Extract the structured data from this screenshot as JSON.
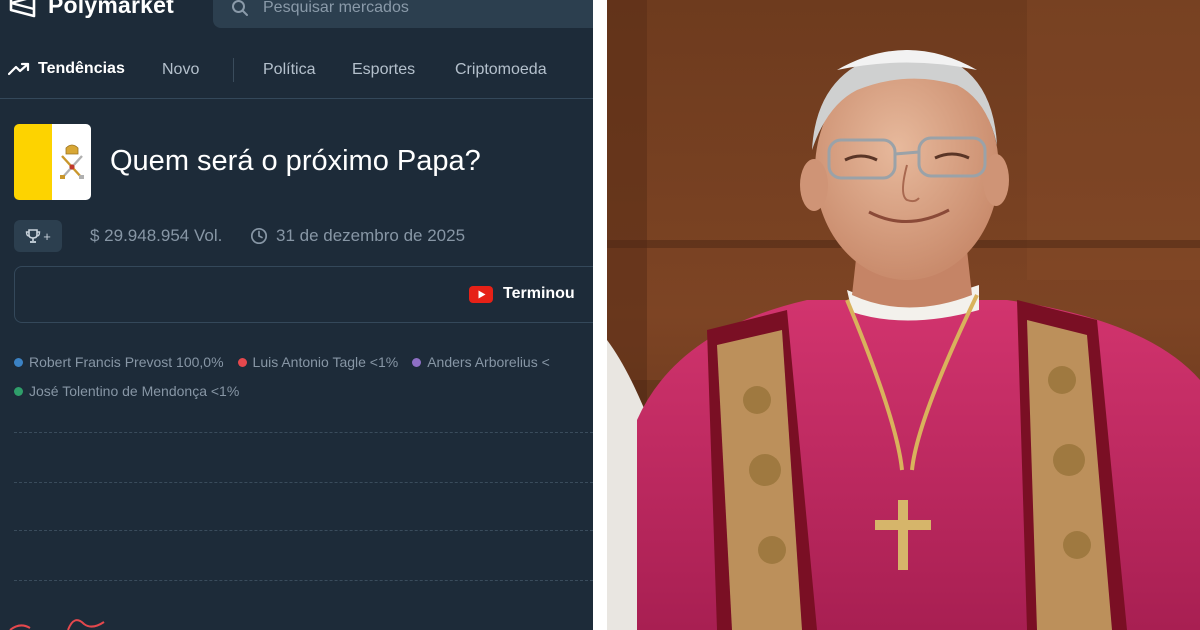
{
  "app": {
    "name": "Polymarket",
    "search_placeholder": "Pesquisar mercados"
  },
  "nav": {
    "trending": "Tendências",
    "items": [
      "Novo",
      "Política",
      "Esportes",
      "Criptomoeda"
    ]
  },
  "market": {
    "title": "Quem será o próximo Papa?",
    "volume": "$ 29.948.954 Vol.",
    "end_date": "31 de dezembro de 2025",
    "status": "Terminou",
    "trophy_suffix": "+"
  },
  "legend": [
    {
      "label": "Robert Francis Prevost 100,0%",
      "color": "#3b82c4"
    },
    {
      "label": "Luis Antonio Tagle <1%",
      "color": "#e5484d"
    },
    {
      "label": "Anders Arborelius <",
      "color": "#8e6fc5"
    },
    {
      "label": "José Tolentino de Mendonça <1%",
      "color": "#2f9e6a"
    }
  ],
  "colors": {
    "panel_bg": "#1d2b39",
    "flag_yellow": "#fdd300",
    "youtube_red": "#e62117"
  },
  "icons": [
    "polymarket-logo-icon",
    "search-icon",
    "trending-icon",
    "trophy-icon",
    "clock-icon",
    "youtube-icon",
    "papal-keys-icon"
  ]
}
